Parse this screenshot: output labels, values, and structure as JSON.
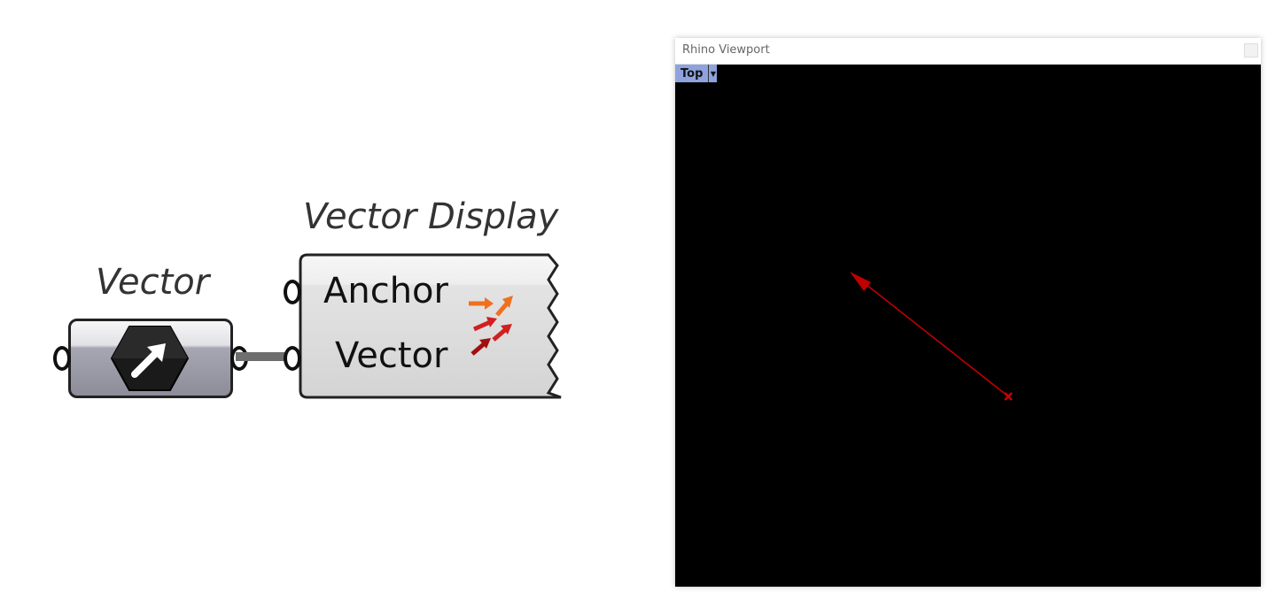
{
  "components": {
    "vector_param": {
      "nickname": "Vector",
      "icon": "vector-arrow-icon"
    },
    "vector_display": {
      "nickname": "Vector Display",
      "inputs": [
        "Anchor",
        "Vector"
      ],
      "icon": "vector-display-icon"
    }
  },
  "viewport": {
    "title": "Rhino Viewport",
    "view_name": "Top",
    "background": "#000000",
    "vector_color": "#cc0000"
  }
}
